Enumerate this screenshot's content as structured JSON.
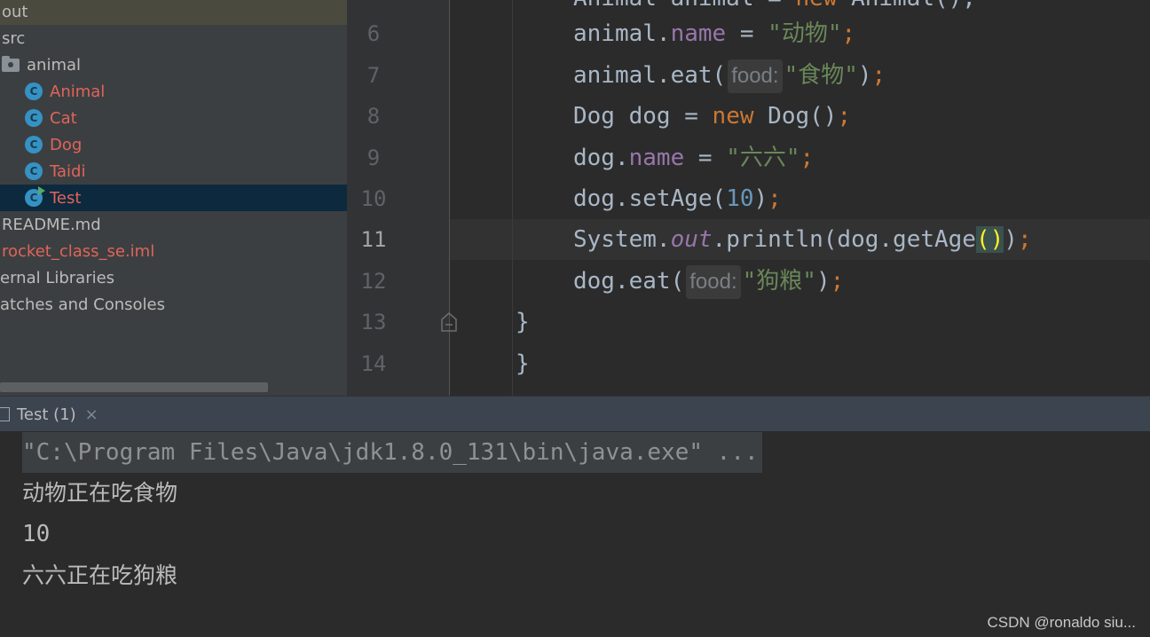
{
  "project_tree": {
    "items": [
      {
        "label": "out",
        "kind": "folder"
      },
      {
        "label": "src",
        "kind": "folder"
      },
      {
        "label": "animal",
        "kind": "package"
      },
      {
        "label": "Animal",
        "kind": "class"
      },
      {
        "label": "Cat",
        "kind": "class"
      },
      {
        "label": "Dog",
        "kind": "class"
      },
      {
        "label": "Taidi",
        "kind": "class"
      },
      {
        "label": "Test",
        "kind": "class-main"
      },
      {
        "label": "README.md",
        "kind": "file"
      },
      {
        "label": "rocket_class_se.iml",
        "kind": "file"
      },
      {
        "label": "ernal Libraries",
        "kind": "node"
      },
      {
        "label": "atches and Consoles",
        "kind": "node"
      }
    ],
    "class_icon_letter": "C"
  },
  "editor": {
    "line_numbers": [
      "6",
      "7",
      "8",
      "9",
      "10",
      "11",
      "12",
      "13",
      "14"
    ],
    "current_line": "11",
    "top_partial": {
      "t1": "Animal animal = ",
      "t2": "new",
      "t3": " Animal();"
    },
    "lines": {
      "l6": {
        "a": "animal.",
        "b": "name",
        "c": " = ",
        "d": "\"动物\"",
        "e": ";"
      },
      "l7": {
        "a": "animal.eat(",
        "hint": "food:",
        "d": "\"食物\"",
        "c": ")",
        "e": ";"
      },
      "l8": {
        "a": "Dog dog = ",
        "kw": "new",
        "c": " Dog()",
        "e": ";"
      },
      "l9": {
        "a": "dog.",
        "b": "name",
        "c": " = ",
        "d": "\"六六\"",
        "e": ";"
      },
      "l10": {
        "a": "dog.setAge(",
        "n": "10",
        "c": ")",
        "e": ";"
      },
      "l11": {
        "a": "System.",
        "s": "out",
        "c": ".println(dog.getAge",
        "p": "()",
        "c2": ")",
        "e": ";"
      },
      "l12": {
        "a": "dog.eat(",
        "hint": "food:",
        "d": "\"狗粮\"",
        "c": ")",
        "e": ";"
      },
      "l13": "}",
      "l14": "}"
    }
  },
  "run_panel": {
    "tab_label": "Test (1)",
    "close_glyph": "×",
    "output": [
      "\"C:\\Program Files\\Java\\jdk1.8.0_131\\bin\\java.exe\" ...",
      "动物正在吃食物",
      "10",
      "六六正在吃狗粮"
    ]
  },
  "watermark": "CSDN @ronaldo siu..."
}
